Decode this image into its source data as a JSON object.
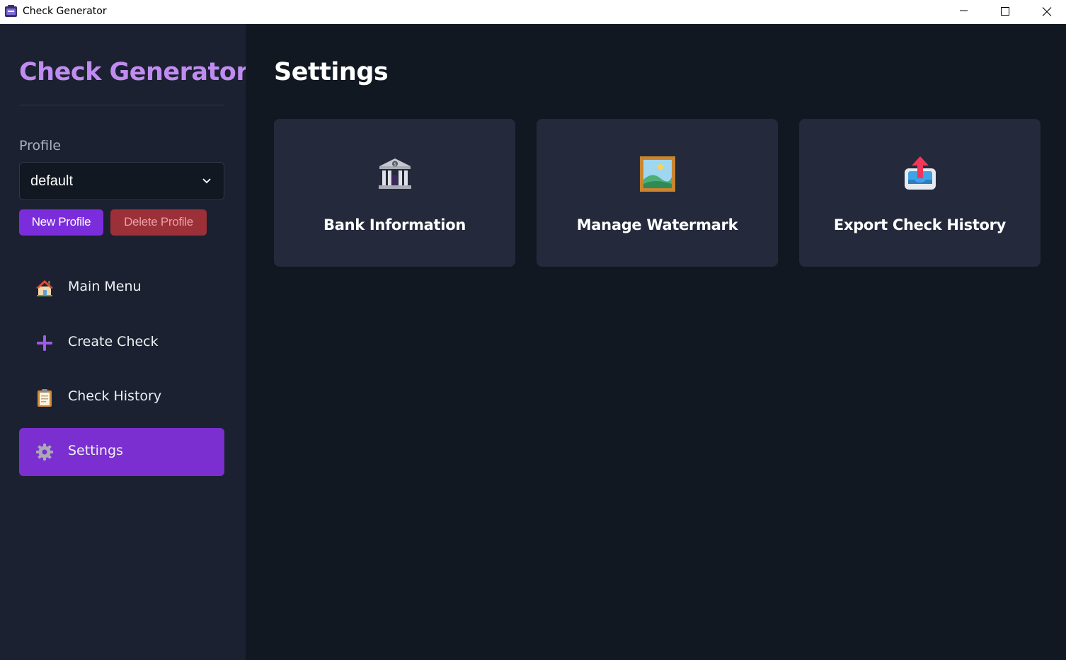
{
  "window": {
    "title": "Check Generator",
    "controls": [
      "minimize-icon",
      "maximize-icon",
      "close-icon"
    ]
  },
  "sidebar": {
    "brand": "Check Generator",
    "profile_label": "Profile",
    "profile_selected": "default",
    "new_profile_label": "New Profile",
    "delete_profile_label": "Delete Profile",
    "nav": [
      {
        "label": "Main Menu",
        "icon": "house-icon",
        "active": false
      },
      {
        "label": "Create Check",
        "icon": "plus-icon",
        "active": false
      },
      {
        "label": "Check History",
        "icon": "clipboard-icon",
        "active": false
      },
      {
        "label": "Settings",
        "icon": "gear-icon",
        "active": true
      }
    ]
  },
  "main": {
    "title": "Settings",
    "cards": [
      {
        "label": "Bank Information",
        "icon": "bank-icon"
      },
      {
        "label": "Manage Watermark",
        "icon": "framed-picture-icon"
      },
      {
        "label": "Export Check History",
        "icon": "outbox-tray-icon"
      }
    ]
  },
  "colors": {
    "accent": "#7b2fd1",
    "brand_text": "#c08cf0",
    "danger": "#9c3038",
    "sidebar_bg": "#1b2130",
    "main_bg": "#111822",
    "card_bg": "#242a3b"
  }
}
